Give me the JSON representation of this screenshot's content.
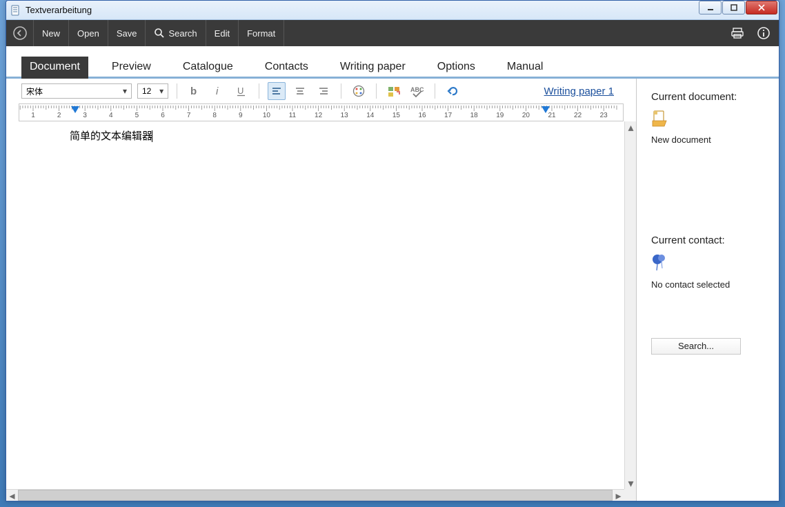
{
  "window": {
    "title": "Textverarbeitung"
  },
  "toolbar": {
    "new": "New",
    "open": "Open",
    "save": "Save",
    "search": "Search",
    "edit": "Edit",
    "format": "Format"
  },
  "tabs": {
    "document": "Document",
    "preview": "Preview",
    "catalogue": "Catalogue",
    "contacts": "Contacts",
    "writing_paper": "Writing paper",
    "options": "Options",
    "manual": "Manual"
  },
  "format": {
    "font_name": "宋体",
    "font_size": "12",
    "writing_paper_link": "Writing paper 1"
  },
  "ruler": {
    "numbers": [
      1,
      2,
      3,
      4,
      5,
      6,
      7,
      8,
      9,
      10,
      11,
      12,
      13,
      14,
      15,
      16,
      17,
      18,
      19,
      20,
      21,
      22,
      23
    ]
  },
  "document": {
    "body_text": "简单的文本编辑器"
  },
  "side": {
    "current_document_label": "Current document:",
    "current_document_value": "New document",
    "current_contact_label": "Current contact:",
    "current_contact_value": "No contact selected",
    "search_button": "Search..."
  }
}
